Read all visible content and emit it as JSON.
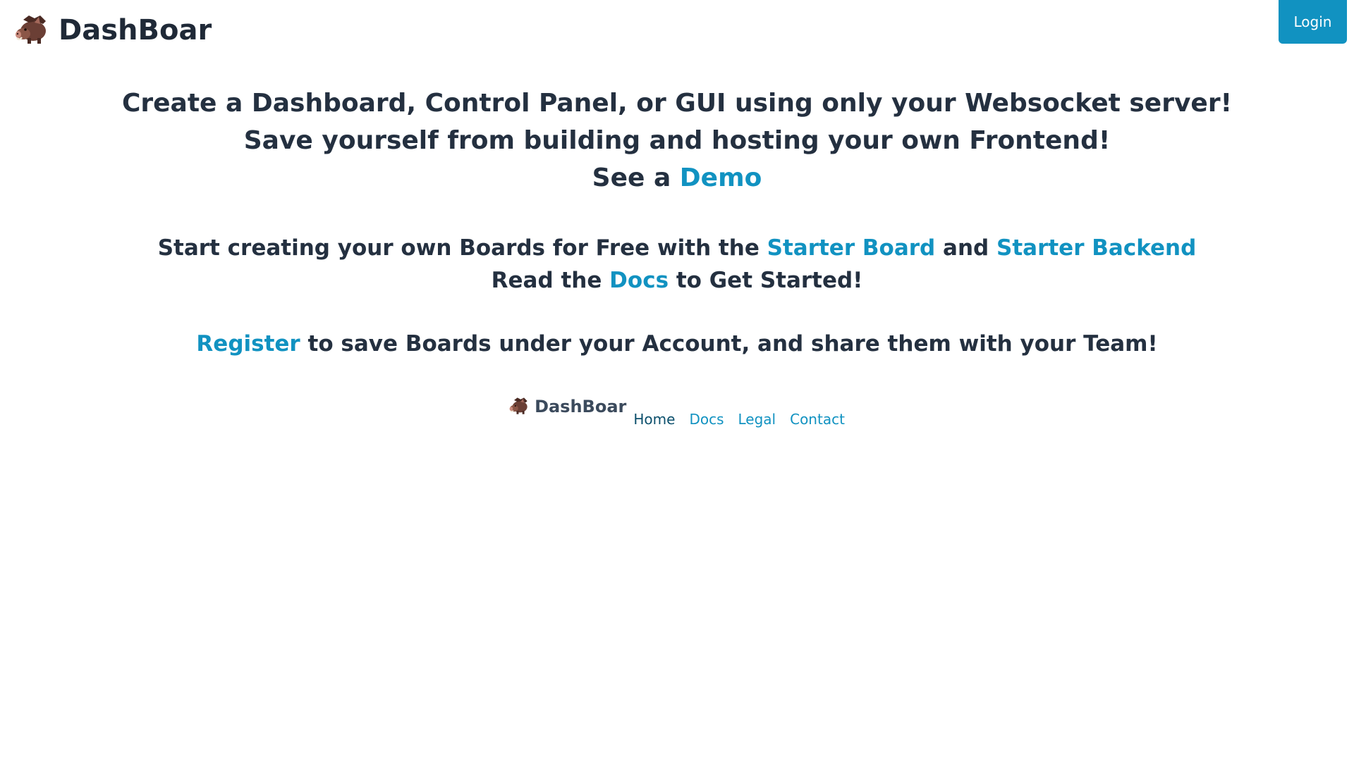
{
  "header": {
    "brand": "DashBoar",
    "login_label": "Login"
  },
  "hero": {
    "line1": "Create a Dashboard, Control Panel, or GUI using only your Websocket server!",
    "line2": "Save yourself from building and hosting your own Frontend!",
    "line3_prefix": "See a ",
    "demo_link": "Demo"
  },
  "starter": {
    "prefix": "Start creating your own Boards for Free with the ",
    "starter_board_link": "Starter Board",
    "and": " and ",
    "starter_backend_link": "Starter Backend"
  },
  "docs_line": {
    "prefix": "Read the ",
    "docs_link": "Docs",
    "suffix": " to Get Started!"
  },
  "register_line": {
    "register_link": "Register",
    "suffix": " to save Boards under your Account, and share them with your Team!"
  },
  "footer": {
    "brand": "DashBoar",
    "links": [
      {
        "label": "Home"
      },
      {
        "label": "Docs"
      },
      {
        "label": "Legal"
      },
      {
        "label": "Contact"
      }
    ]
  },
  "colors": {
    "accent": "#1192c1",
    "text": "#243040",
    "boar": "#7a4a3c"
  },
  "icons": {
    "logo": "boar-icon"
  }
}
